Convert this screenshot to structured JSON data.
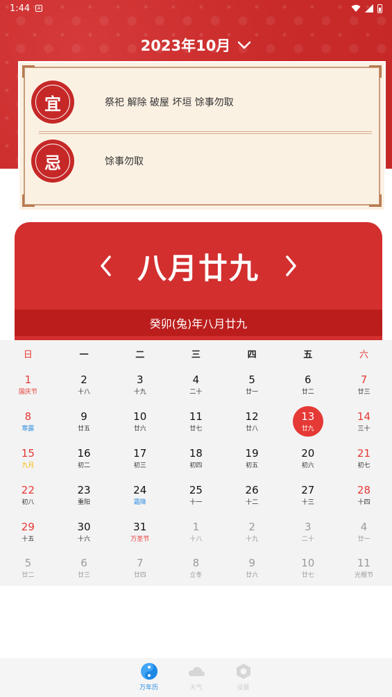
{
  "status_bar": {
    "time": "1:44",
    "notif_glyph": "A"
  },
  "header": {
    "month_label": "2023年10月"
  },
  "almanac": {
    "yi_seal": "宜",
    "yi_text": "祭祀 解除 破屋 坏垣 馀事勿取",
    "ji_seal": "忌",
    "ji_text": "馀事勿取"
  },
  "lunar": {
    "title": "八月廿九",
    "subtitle": "癸卯(兔)年八月廿九"
  },
  "calendar": {
    "weekdays": [
      "日",
      "一",
      "二",
      "三",
      "四",
      "五",
      "六"
    ],
    "weeks": [
      [
        {
          "n": "1",
          "l": "国庆节"
        },
        {
          "n": "2",
          "l": "十八"
        },
        {
          "n": "3",
          "l": "十九"
        },
        {
          "n": "4",
          "l": "二十"
        },
        {
          "n": "5",
          "l": "廿一"
        },
        {
          "n": "6",
          "l": "廿二"
        },
        {
          "n": "7",
          "l": "廿三"
        }
      ],
      [
        {
          "n": "8",
          "l": "寒露"
        },
        {
          "n": "9",
          "l": "廿五"
        },
        {
          "n": "10",
          "l": "廿六"
        },
        {
          "n": "11",
          "l": "廿七"
        },
        {
          "n": "12",
          "l": "廿八"
        },
        {
          "n": "13",
          "l": "廿九"
        },
        {
          "n": "14",
          "l": "三十"
        }
      ],
      [
        {
          "n": "15",
          "l": "九月"
        },
        {
          "n": "16",
          "l": "初二"
        },
        {
          "n": "17",
          "l": "初三"
        },
        {
          "n": "18",
          "l": "初四"
        },
        {
          "n": "19",
          "l": "初五"
        },
        {
          "n": "20",
          "l": "初六"
        },
        {
          "n": "21",
          "l": "初七"
        }
      ],
      [
        {
          "n": "22",
          "l": "初八"
        },
        {
          "n": "23",
          "l": "重阳"
        },
        {
          "n": "24",
          "l": "霜降"
        },
        {
          "n": "25",
          "l": "十一"
        },
        {
          "n": "26",
          "l": "十二"
        },
        {
          "n": "27",
          "l": "十三"
        },
        {
          "n": "28",
          "l": "十四"
        }
      ],
      [
        {
          "n": "29",
          "l": "十五"
        },
        {
          "n": "30",
          "l": "十六"
        },
        {
          "n": "31",
          "l": "万圣节"
        },
        {
          "n": "1",
          "l": "十八"
        },
        {
          "n": "2",
          "l": "十九"
        },
        {
          "n": "3",
          "l": "二十"
        },
        {
          "n": "4",
          "l": "廿一"
        }
      ],
      [
        {
          "n": "5",
          "l": "廿二"
        },
        {
          "n": "6",
          "l": "廿三"
        },
        {
          "n": "7",
          "l": "廿四"
        },
        {
          "n": "8",
          "l": "立冬"
        },
        {
          "n": "9",
          "l": "廿六"
        },
        {
          "n": "10",
          "l": "廿七"
        },
        {
          "n": "11",
          "l": "光棍节"
        }
      ]
    ]
  },
  "bottom_nav": [
    {
      "label": "万年历",
      "icon": "yin-yang-icon"
    },
    {
      "label": "天气",
      "icon": "cloud-icon"
    },
    {
      "label": "设置",
      "icon": "hexagon-settings-icon"
    }
  ],
  "colors": {
    "primary_red": "#d32f2f",
    "accent_blue": "#1e88e5",
    "weekend_red": "#e53935"
  }
}
